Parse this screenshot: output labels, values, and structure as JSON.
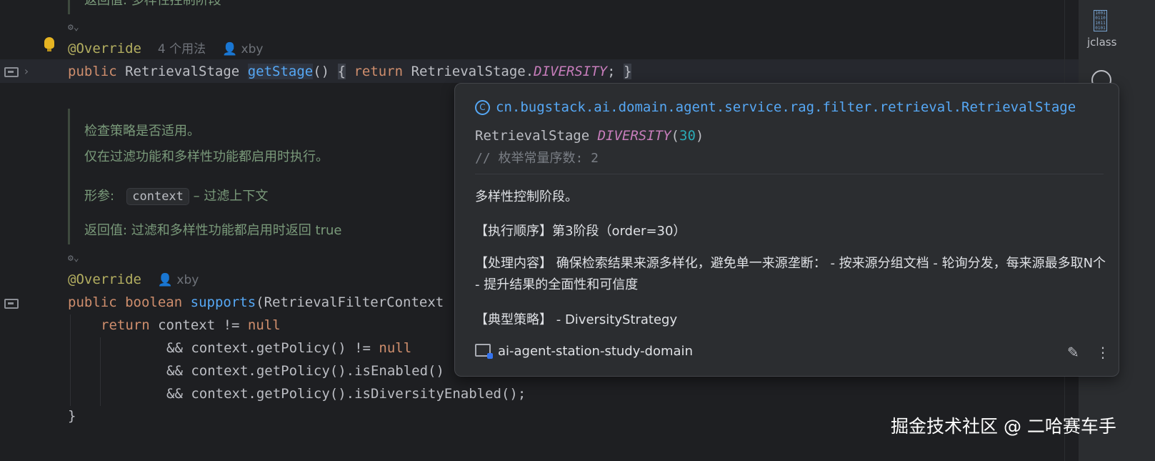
{
  "editor": {
    "top_doc_fragment": "返回值: 多样性控制阶段",
    "method1": {
      "annotation": "@Override",
      "usages_hint": "4 个用法",
      "author_hint": "xby",
      "kw_public": "public",
      "type": "RetrievalStage",
      "name": "getStage",
      "parens": "()",
      "open_brace": "{",
      "kw_return": "return",
      "ret_class": "RetrievalStage.",
      "ret_const": "DIVERSITY",
      "semicolon": ";",
      "close_brace": "}"
    },
    "doc": {
      "line1": "检查策略是否适用。",
      "line2": "仅在过滤功能和多样性功能都启用时执行。",
      "param_label": "形参:",
      "param_name": "context",
      "param_desc": "– 过滤上下文",
      "returns": "返回值: 过滤和多样性功能都启用时返回 ",
      "returns_true": "true"
    },
    "method2": {
      "annotation": "@Override",
      "author_hint": "xby",
      "kw_public": "public",
      "kw_boolean": "boolean",
      "name": "supports",
      "params": "(RetrievalFilterContext",
      "kw_return": "return",
      "line_return_rest": " context != ",
      "kw_null": "null",
      "line2_pre": "&& context.getPolicy() != ",
      "line3": "&& context.getPolicy().isEnabled()",
      "line4": "&& context.getPolicy().isDiversityEnabled();",
      "close_brace": "}"
    }
  },
  "popup": {
    "fqn": "cn.bugstack.ai.domain.agent.service.rag.filter.retrieval.RetrievalStage",
    "fqn_icon": "C",
    "sig_type": "RetrievalStage ",
    "sig_const": "DIVERSITY",
    "sig_open": "(",
    "sig_num": "30",
    "sig_close": ")",
    "comment": "// 枚举常量序数: 2",
    "desc": "多样性控制阶段。",
    "order": "【执行顺序】第3阶段（order=30）",
    "content": "【处理内容】 确保检索结果来源多样化，避免单一来源垄断： - 按来源分组文档 - 轮询分发，每来源最多取N个 - 提升结果的全面性和可信度",
    "strategy": "【典型策略】 - DiversityStrategy",
    "module": "ai-agent-station-study-domain",
    "edit_glyph": "✎",
    "more_glyph": "⋮"
  },
  "right_toolbar": {
    "label": "jclass"
  },
  "watermark": "掘金技术社区 @ 二哈赛车手",
  "colors": {
    "editor_bg": "#1e1f22",
    "keyword": "#cf8e6d",
    "function": "#56a8f5",
    "annotation": "#b3ae60",
    "constant": "#c77dbb",
    "number": "#2aacb8",
    "popup_bg": "#2b2d30"
  }
}
